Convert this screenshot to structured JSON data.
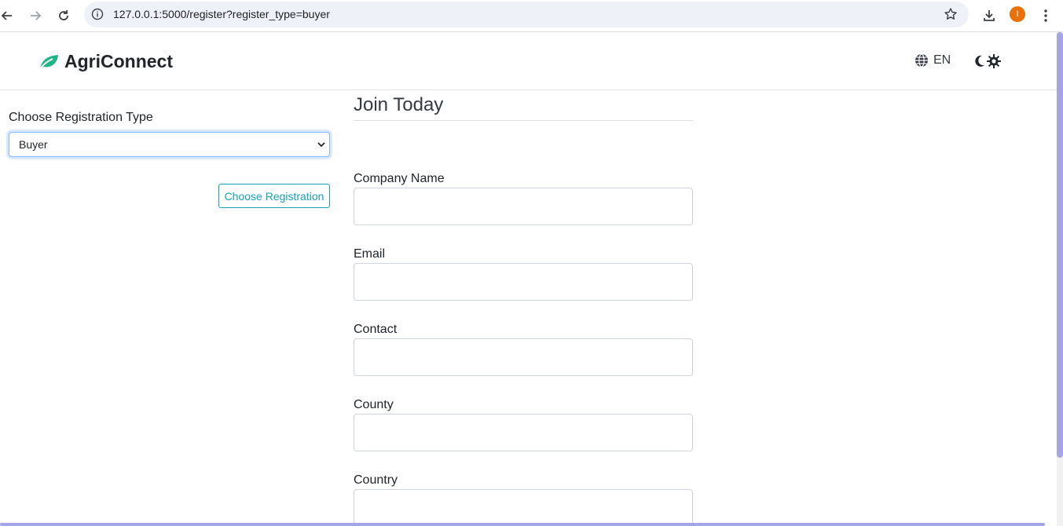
{
  "browser": {
    "url": "127.0.0.1:5000/register?register_type=buyer",
    "profile_initial": "I"
  },
  "navbar": {
    "brand": "AgriConnect",
    "language": "EN"
  },
  "registration_type": {
    "label": "Choose Registration Type",
    "selected": "Buyer",
    "button": "Choose Registration"
  },
  "form": {
    "title": "Join Today",
    "fields": [
      {
        "label": "Company Name",
        "value": ""
      },
      {
        "label": "Email",
        "value": ""
      },
      {
        "label": "Contact",
        "value": ""
      },
      {
        "label": "County",
        "value": ""
      },
      {
        "label": "Country",
        "value": ""
      }
    ]
  },
  "colors": {
    "brand_green": "#20b486",
    "accent_teal": "#17a2b8",
    "scrollbar": "#a5a5e6"
  }
}
